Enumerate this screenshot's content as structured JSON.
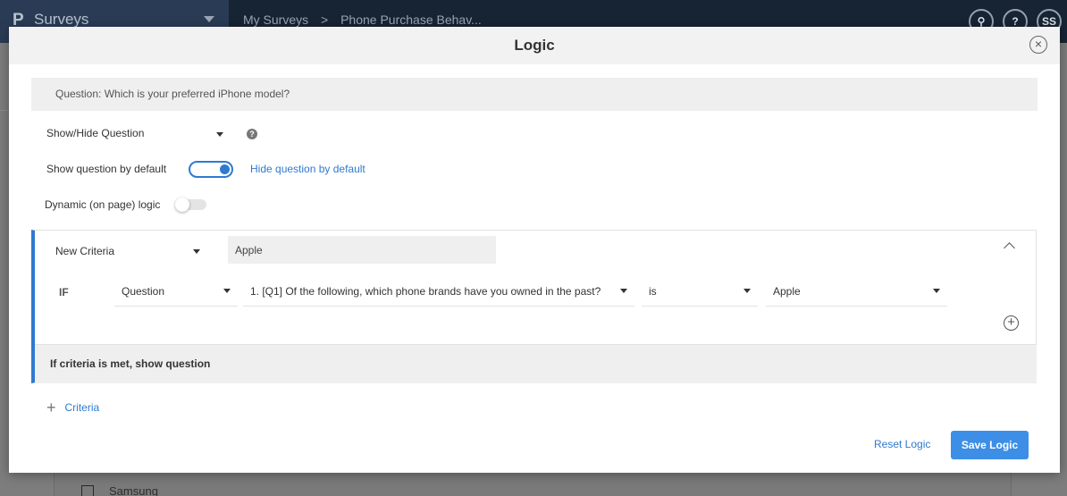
{
  "app": {
    "brand_logo": "P",
    "brand_name": "Surveys",
    "breadcrumb": [
      "My Surveys",
      ">",
      "Phone Purchase Behav..."
    ],
    "top_icons": [
      {
        "name": "search-icon",
        "glyph": "⚲"
      },
      {
        "name": "help-icon",
        "glyph": "?"
      },
      {
        "name": "user-avatar",
        "glyph": "SS"
      }
    ],
    "background_option": "Samsung"
  },
  "modal": {
    "title": "Logic",
    "close_glyph": "×",
    "question": "Question: Which is your preferred iPhone model?",
    "logic_type": "Show/Hide Question",
    "help_glyph": "?",
    "show_by_default_label": "Show question by default",
    "show_by_default_on": true,
    "hide_by_default_label": "Hide question by default",
    "dynamic_logic_label": "Dynamic (on page) logic",
    "dynamic_logic_on": false,
    "criteria": {
      "name_type": "New Criteria",
      "name_value": "Apple",
      "if_label": "IF",
      "source_type": "Question",
      "question": "1. [Q1] Of the following, which phone brands have you owned in the past?",
      "operator": "is",
      "value": "Apple",
      "add_row_glyph": "+",
      "action_text": "If criteria is met, show question"
    },
    "add_criteria_plus": "+",
    "add_criteria_label": "Criteria",
    "reset_label": "Reset Logic",
    "save_label": "Save Logic"
  },
  "colors": {
    "accent": "#2e7ad1",
    "save_button": "#3d8ee6",
    "topbar": "#172434",
    "overlay": "#7d7d7d"
  }
}
